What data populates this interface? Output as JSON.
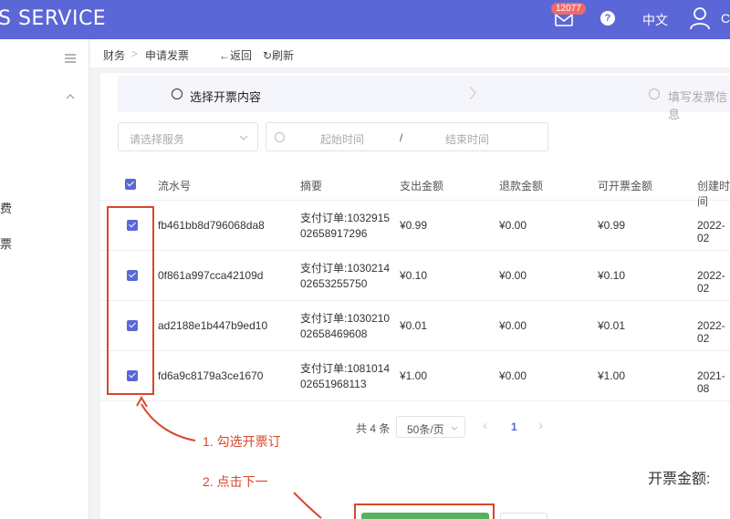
{
  "header": {
    "brand": "S SERVICE",
    "notification_count": "12077",
    "help_glyph": "?",
    "language": "中文",
    "user_cut": "C"
  },
  "sidebar": {
    "items": [
      {
        "label": "消费"
      },
      {
        "label": "发票"
      }
    ]
  },
  "breadcrumb": {
    "items": [
      "财务",
      "申请发票"
    ],
    "back_label": "←返回",
    "refresh_label": "↻刷新"
  },
  "steps": [
    {
      "label": "选择开票内容"
    },
    {
      "label": "填写发票信息"
    }
  ],
  "filters": {
    "service_placeholder": "请选择服务",
    "start_placeholder": "起始时间",
    "separator": "/",
    "end_placeholder": "结束时间"
  },
  "table": {
    "columns": [
      "流水号",
      "摘要",
      "支出金额",
      "退款金额",
      "可开票金额",
      "创建时间"
    ],
    "rows": [
      {
        "serial": "fb461bb8d796068da8",
        "summary_line1": "支付订单:1032915",
        "summary_line2": "02658917296",
        "expense": "¥0.99",
        "refund": "¥0.00",
        "invoiceable": "¥0.99",
        "created": "2022-02"
      },
      {
        "serial": "0f861a997cca42109d",
        "summary_line1": "支付订单:1030214",
        "summary_line2": "02653255750",
        "expense": "¥0.10",
        "refund": "¥0.00",
        "invoiceable": "¥0.10",
        "created": "2022-02"
      },
      {
        "serial": "ad2188e1b447b9ed10",
        "summary_line1": "支付订单:1030210",
        "summary_line2": "02658469608",
        "expense": "¥0.01",
        "refund": "¥0.00",
        "invoiceable": "¥0.01",
        "created": "2022-02"
      },
      {
        "serial": "fd6a9c8179a3ce1670",
        "summary_line1": "支付订单:1081014",
        "summary_line2": "02651968113",
        "expense": "¥1.00",
        "refund": "¥0.00",
        "invoiceable": "¥1.00",
        "created": "2021-08"
      }
    ]
  },
  "pagination": {
    "total": "共 4 条",
    "page_size": "50条/页",
    "prev": "‹",
    "current": "1",
    "next": "›"
  },
  "annotations": {
    "step1": "1. 勾选开票订",
    "step2": "2. 点击下一"
  },
  "summary": {
    "amount_label": "开票金额:"
  },
  "colors": {
    "header_bg": "#5b67d6",
    "accent": "#5b67d6",
    "annotation_red": "#d9472b",
    "next_green": "#57b15d",
    "badge_red": "#f06a6a"
  }
}
